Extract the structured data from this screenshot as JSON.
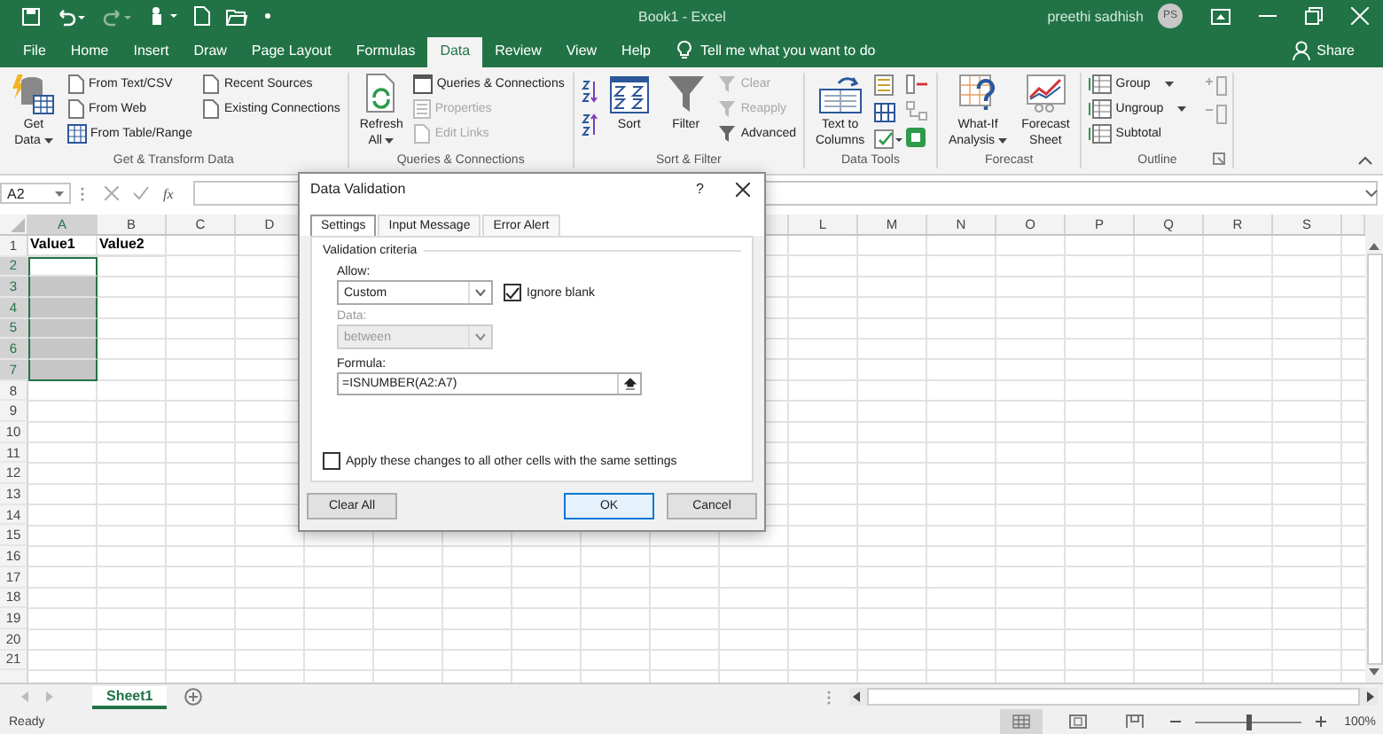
{
  "title_bar": {
    "title": "Book1  -  Excel",
    "user": "preethi sadhish",
    "initials": "PS"
  },
  "menu_tabs": [
    {
      "label": "File",
      "selected": false
    },
    {
      "label": "Home",
      "selected": false
    },
    {
      "label": "Insert",
      "selected": false
    },
    {
      "label": "Draw",
      "selected": false
    },
    {
      "label": "Page Layout",
      "selected": false
    },
    {
      "label": "Formulas",
      "selected": false
    },
    {
      "label": "Data",
      "selected": true
    },
    {
      "label": "Review",
      "selected": false
    },
    {
      "label": "View",
      "selected": false
    },
    {
      "label": "Help",
      "selected": false
    }
  ],
  "tell_me": "Tell me what you want to do",
  "share": "Share",
  "ribbon": {
    "groups": [
      {
        "label": "Get & Transform Data",
        "large": [
          {
            "lines": [
              "Get",
              "Data"
            ],
            "menu": true
          }
        ],
        "small": [
          {
            "label": "From Text/CSV",
            "disabled": false
          },
          {
            "label": "From Web",
            "disabled": false
          },
          {
            "label": "From Table/Range",
            "disabled": false
          },
          {
            "label": "Recent Sources",
            "disabled": false
          },
          {
            "label": "Existing Connections",
            "disabled": false
          }
        ]
      },
      {
        "label": "Queries & Connections",
        "large": [
          {
            "lines": [
              "Refresh",
              "All"
            ],
            "menu": true
          }
        ],
        "small": [
          {
            "label": "Queries & Connections",
            "disabled": false
          },
          {
            "label": "Properties",
            "disabled": true
          },
          {
            "label": "Edit Links",
            "disabled": true
          }
        ]
      },
      {
        "label": "Sort & Filter",
        "large": [
          {
            "lines": [
              "Sort"
            ],
            "menu": false
          },
          {
            "lines": [
              "Filter"
            ],
            "menu": false
          }
        ],
        "small": [
          {
            "label": "Clear",
            "disabled": true
          },
          {
            "label": "Reapply",
            "disabled": true
          },
          {
            "label": "Advanced",
            "disabled": false
          }
        ]
      },
      {
        "label": "Data Tools",
        "large": [
          {
            "lines": [
              "Text to",
              "Columns"
            ],
            "menu": false
          }
        ]
      },
      {
        "label": "Forecast",
        "large": [
          {
            "lines": [
              "What-If",
              "Analysis"
            ],
            "menu": true
          },
          {
            "lines": [
              "Forecast",
              "Sheet"
            ],
            "menu": false
          }
        ]
      },
      {
        "label": "Outline",
        "small": [
          {
            "label": "Group",
            "disabled": false,
            "menu": true
          },
          {
            "label": "Ungroup",
            "disabled": false,
            "menu": true
          },
          {
            "label": "Subtotal",
            "disabled": false,
            "menu": false
          }
        ]
      }
    ]
  },
  "formula_bar": {
    "name_box": "A2",
    "function_button": "fx"
  },
  "columns_left": [
    {
      "label": "A",
      "selected": true
    },
    {
      "label": "B",
      "selected": false
    },
    {
      "label": "C",
      "selected": false
    },
    {
      "label": "D",
      "selected": false
    }
  ],
  "columns_right": [
    {
      "label": "L",
      "selected": false
    },
    {
      "label": "M",
      "selected": false
    },
    {
      "label": "N",
      "selected": false
    },
    {
      "label": "O",
      "selected": false
    },
    {
      "label": "P",
      "selected": false
    },
    {
      "label": "Q",
      "selected": false
    },
    {
      "label": "R",
      "selected": false
    },
    {
      "label": "S",
      "selected": false
    }
  ],
  "rows": [
    {
      "number": "1",
      "cells": [
        {
          "text": "Value1",
          "selected": false
        },
        {
          "text": "Value2",
          "selected": false
        }
      ]
    },
    {
      "number": "2",
      "cells": [
        {
          "selected": true,
          "active": true
        }
      ]
    },
    {
      "number": "3",
      "cells": [
        {
          "selected": true,
          "active": false
        }
      ]
    },
    {
      "number": "4",
      "cells": [
        {
          "selected": true,
          "active": false
        }
      ]
    },
    {
      "number": "5",
      "cells": [
        {
          "selected": true,
          "active": false
        }
      ]
    },
    {
      "number": "6",
      "cells": [
        {
          "selected": true,
          "active": false
        }
      ]
    },
    {
      "number": "7",
      "cells": [
        {
          "selected": true,
          "active": false
        }
      ]
    },
    {
      "number": "8"
    },
    {
      "number": "9"
    },
    {
      "number": "10"
    },
    {
      "number": "11"
    },
    {
      "number": "12"
    },
    {
      "number": "13"
    },
    {
      "number": "14"
    },
    {
      "number": "15"
    },
    {
      "number": "16"
    },
    {
      "number": "17"
    },
    {
      "number": "18"
    },
    {
      "number": "19"
    },
    {
      "number": "20"
    },
    {
      "number": "21"
    }
  ],
  "dialog": {
    "title": "Data Validation",
    "help": "?",
    "tabs": [
      {
        "label": "Settings",
        "selected": true
      },
      {
        "label": "Input Message",
        "selected": false
      },
      {
        "label": "Error Alert",
        "selected": false
      }
    ],
    "section": "Validation criteria",
    "allow_label": "Allow:",
    "allow_value": "Custom",
    "ignore_blank": {
      "label": "Ignore blank",
      "checked": true
    },
    "data_label": "Data:",
    "data_value": "between",
    "data_disabled": true,
    "formula_label": "Formula:",
    "formula_value": "=ISNUMBER(A2:A7)",
    "apply_all": {
      "label": "Apply these changes to all other cells with the same settings",
      "checked": false
    },
    "buttons": [
      {
        "label": "Clear All",
        "default": false
      },
      {
        "label": "OK",
        "default": true
      },
      {
        "label": "Cancel",
        "default": false
      }
    ]
  },
  "sheets": [
    {
      "label": "Sheet1",
      "selected": true
    }
  ],
  "status_bar": {
    "status": "Ready",
    "views": [
      {
        "selected": true
      },
      {
        "selected": false
      },
      {
        "selected": false
      }
    ],
    "zoom": {
      "level": 0.5,
      "label": "100%"
    }
  }
}
